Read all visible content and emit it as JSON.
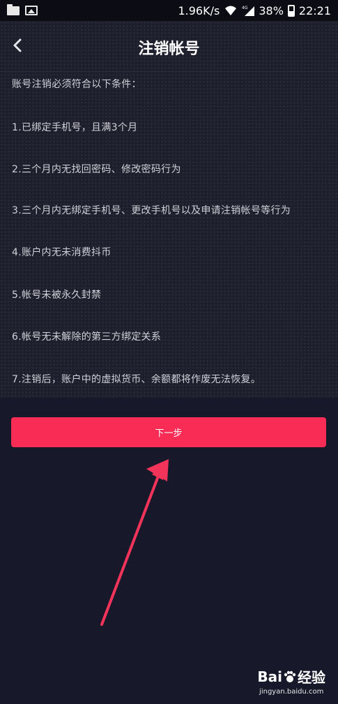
{
  "status_bar": {
    "speed": "1.96K/s",
    "battery": "38%",
    "time": "22:21",
    "network_label": "4G"
  },
  "nav": {
    "title": "注销帐号"
  },
  "content": {
    "intro": "账号注销必须符合以下条件：",
    "conditions": [
      "1.已绑定手机号，且满3个月",
      "2.三个月内无找回密码、修改密码行为",
      "3.三个月内无绑定手机号、更改手机号以及申请注销帐号等行为",
      "4.账户内无未消费抖币",
      "5.帐号未被永久封禁",
      "6.帐号无未解除的第三方绑定关系",
      "7.注销后，账户中的虚拟货币、余额都将作废无法恢复。"
    ]
  },
  "next_button": {
    "label": "下一步"
  },
  "watermark": {
    "logo_text_1": "Bai",
    "logo_text_2": "经验",
    "url": "jingyan.baidu.com"
  },
  "colors": {
    "accent": "#f82c55",
    "background": "#17182a",
    "content_bg": "#1e1f2d"
  }
}
